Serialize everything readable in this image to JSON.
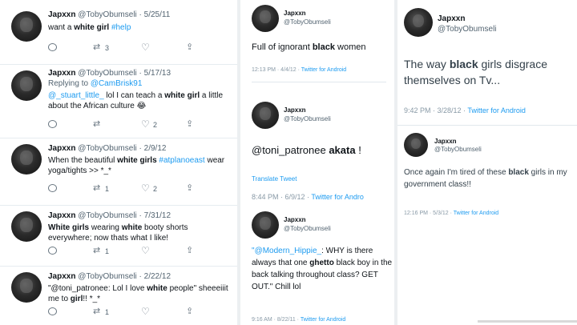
{
  "user": {
    "name": "Japxxn",
    "handle": "@TobyObumseli"
  },
  "left_tweets": [
    {
      "date": "5/25/11",
      "parts": [
        {
          "t": "want a "
        },
        {
          "t": "white girl",
          "b": true
        },
        {
          "t": " "
        },
        {
          "t": "#help",
          "c": "blue"
        }
      ],
      "retweets": "3",
      "likes": ""
    },
    {
      "date": "5/17/13",
      "reply_label": "Replying to ",
      "reply_to": "@CamBrisk91",
      "parts": [
        {
          "t": "@_stuart_little_",
          "c": "blue"
        },
        {
          "t": " lol I can teach a "
        },
        {
          "t": "white girl",
          "b": true
        },
        {
          "t": " a little about the African culture 😂"
        }
      ],
      "retweets": "",
      "likes": "2"
    },
    {
      "date": "2/9/12",
      "parts": [
        {
          "t": "When the beautiful "
        },
        {
          "t": "white girls",
          "b": true
        },
        {
          "t": " "
        },
        {
          "t": "#atplanoeast",
          "c": "blue"
        },
        {
          "t": " wear yoga/tights >> *_*"
        }
      ],
      "retweets": "1",
      "likes": "2"
    },
    {
      "date": "7/31/12",
      "parts": [
        {
          "t": "White girls",
          "b": true
        },
        {
          "t": " wearing "
        },
        {
          "t": "white",
          "b": true
        },
        {
          "t": " booty shorts everywhere; now thats what I like!"
        }
      ],
      "retweets": "1",
      "likes": ""
    },
    {
      "date": "2/22/12",
      "parts": [
        {
          "t": "\"@toni_patronee: Lol I love "
        },
        {
          "t": "white",
          "b": true
        },
        {
          "t": " people\" sheeeiiit me to "
        },
        {
          "t": "girl",
          "b": true
        },
        {
          "t": "!! *_*"
        }
      ],
      "retweets": "1",
      "likes": ""
    }
  ],
  "mid_cards": [
    {
      "parts": [
        {
          "t": "Full of ignorant "
        },
        {
          "t": "black",
          "b": true
        },
        {
          "t": " women"
        }
      ],
      "time": "12:13 PM · 4/4/12 · ",
      "source": "Twitter for Android"
    },
    {
      "parts": [
        {
          "t": "@toni_patronee "
        },
        {
          "t": "akata",
          "b": true
        },
        {
          "t": " !"
        }
      ],
      "translate": "Translate Tweet",
      "time": "8:44 PM · 6/9/12 · ",
      "source": "Twitter for Andro"
    },
    {
      "parts": [
        {
          "t": "\"",
          "c": "blue"
        },
        {
          "t": "@Modern_Hippie_",
          "c": "blue"
        },
        {
          "t": ": WHY is there always that one "
        },
        {
          "t": "ghetto",
          "b": true
        },
        {
          "t": " black boy in the back talking throughout class? GET OUT.\" Chill lol"
        }
      ],
      "time": "9:16 AM · 8/22/11 · ",
      "source": "Twitter for Android"
    }
  ],
  "right_cards": [
    {
      "parts": [
        {
          "t": "The way "
        },
        {
          "t": "black",
          "b": true
        },
        {
          "t": " girls disgrace themselves on Tv..."
        }
      ],
      "time": "9:42 PM · 3/28/12 · ",
      "source": "Twitter for Android"
    },
    {
      "parts": [
        {
          "t": "Once again I'm tired of these "
        },
        {
          "t": "black",
          "b": true
        },
        {
          "t": " girls in my government class!!"
        }
      ],
      "time": "12:16 PM · 5/3/12 · ",
      "source": "Twitter for Android"
    }
  ]
}
